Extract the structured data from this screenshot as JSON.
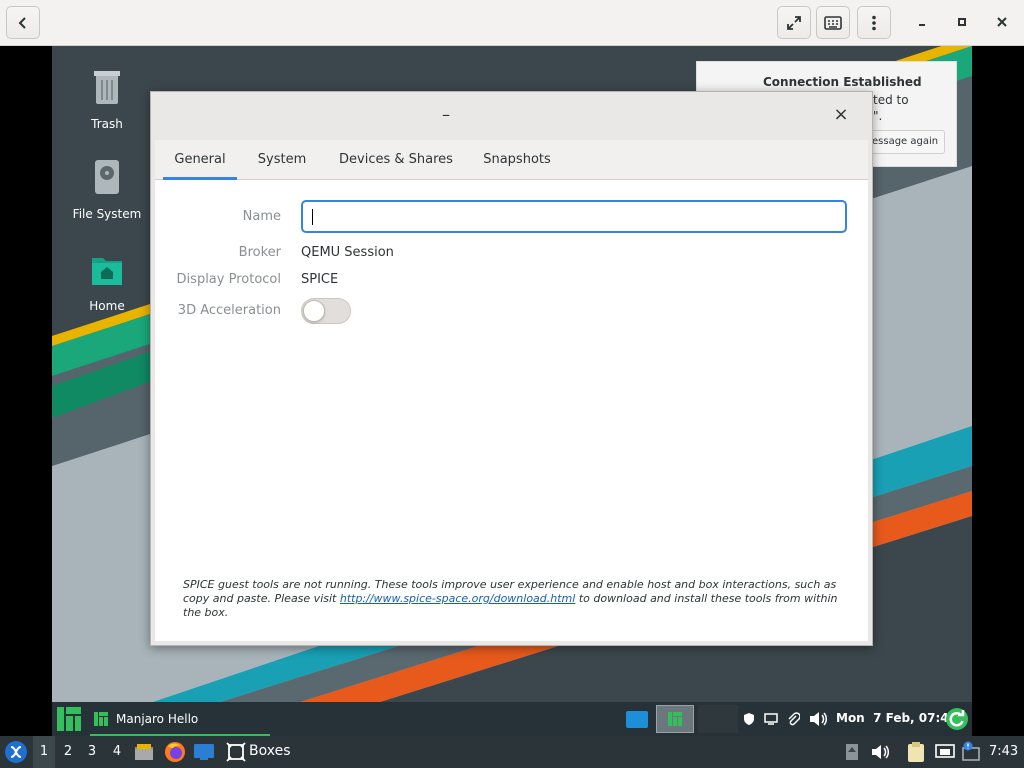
{
  "boxes_header": {
    "back_icon": "chevron-left-icon",
    "fullscreen_icon": "fullscreen-icon",
    "keyboard_icon": "keyboard-icon",
    "menu_icon": "kebab-menu-icon",
    "minimize_icon": "minimize-icon",
    "maximize_icon": "maximize-icon",
    "close_icon": "close-icon"
  },
  "desktop": {
    "icons": [
      {
        "label": "Trash",
        "icon": "trash-icon"
      },
      {
        "label": "File System",
        "icon": "drive-icon"
      },
      {
        "label": "Home",
        "icon": "home-folder-icon"
      }
    ]
  },
  "notification": {
    "title": "Connection Established",
    "body_fragment_1": "ted to",
    "body_fragment_2": "\".",
    "button_fragment": "essage again"
  },
  "dialog": {
    "minimize_symbol": "–",
    "close_symbol": "×",
    "tabs": [
      {
        "label": "General",
        "active": true
      },
      {
        "label": "System",
        "active": false
      },
      {
        "label": "Devices & Shares",
        "active": false
      },
      {
        "label": "Snapshots",
        "active": false
      }
    ],
    "fields": {
      "name_label": "Name",
      "name_value": "",
      "broker_label": "Broker",
      "broker_value": "QEMU Session",
      "protocol_label": "Display Protocol",
      "protocol_value": "SPICE",
      "accel_label": "3D Acceleration",
      "accel_enabled": false
    },
    "footer": {
      "text_before": "SPICE guest tools are not running. These tools improve user experience and enable host and box interactions, such as copy and paste. Please visit ",
      "link": "http://www.spice-space.org/download.html",
      "text_after": " to download and install these tools from within the box."
    }
  },
  "guest_panel": {
    "task_label": "Manjaro Hello",
    "clock": "Mon  7 Feb, 07:43"
  },
  "host_panel": {
    "workspaces": [
      "1",
      "2",
      "3",
      "4"
    ],
    "active_workspace": "1",
    "task_label": "Boxes",
    "clock": "7:43"
  },
  "colors": {
    "accent": "#3584e4",
    "manjaro_green": "#35bf5c",
    "panel_dark": "#263238"
  }
}
